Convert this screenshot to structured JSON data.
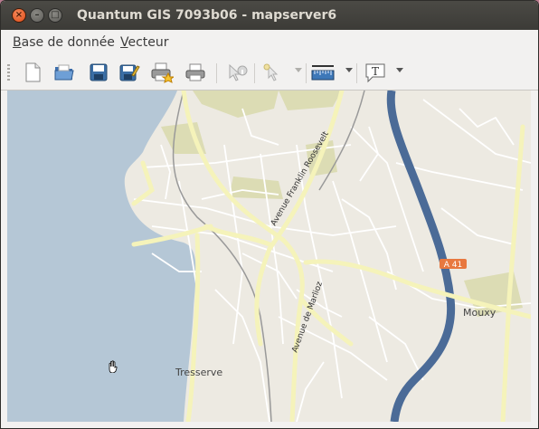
{
  "window": {
    "title": "Quantum GIS 7093b06 - mapserver6",
    "buttons": {
      "close": "×",
      "minimize": "–",
      "maximize": "□"
    }
  },
  "menu": {
    "items": [
      {
        "label": "Base de donnée",
        "accel": "B",
        "rest": "ase de donnée"
      },
      {
        "label": "Vecteur",
        "accel": "V",
        "rest": "ecteur"
      }
    ]
  },
  "toolbar": {
    "tools": [
      {
        "name": "new-project",
        "icon": "new-document-icon",
        "enabled": true
      },
      {
        "name": "open-project",
        "icon": "open-folder-icon",
        "enabled": true
      },
      {
        "name": "save-project",
        "icon": "save-icon",
        "enabled": true
      },
      {
        "name": "save-as",
        "icon": "save-as-icon",
        "enabled": true
      },
      {
        "name": "new-print-composer",
        "icon": "new-print-composer-icon",
        "enabled": true
      },
      {
        "name": "print",
        "icon": "printer-icon",
        "enabled": true
      },
      {
        "name": "identify",
        "icon": "identify-icon",
        "enabled": false
      },
      {
        "name": "select",
        "icon": "select-icon",
        "enabled": false
      },
      {
        "name": "measure",
        "icon": "ruler-icon",
        "enabled": true
      },
      {
        "name": "annotation",
        "icon": "text-annotation-icon",
        "enabled": true
      }
    ],
    "annotation_glyph": "T"
  },
  "map": {
    "labels": {
      "avenue_roosevelt": "Avenue Franklin Roosevelt",
      "avenue_marlioz": "Avenue de Marlioz",
      "highway_shield": "A 41",
      "town_mouxy": "Mouxy",
      "town_tresserve": "Tresserve"
    },
    "colors": {
      "land": "#edeae2",
      "water": "#b5c7d6",
      "major_road": "#f5f3ba",
      "motorway": "#4b6b97",
      "shield": "#e8783f",
      "park": "#dcdcb4"
    }
  }
}
